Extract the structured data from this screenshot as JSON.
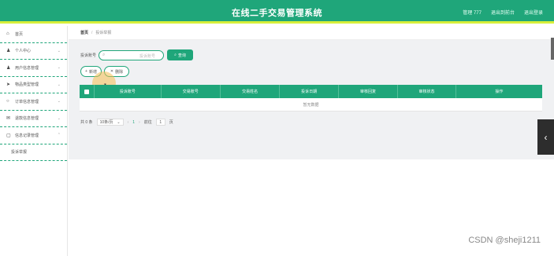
{
  "header": {
    "title": "在线二手交易管理系统",
    "links": [
      "管理 777",
      "退出到前台",
      "退出登录"
    ]
  },
  "sidebar": {
    "items": [
      {
        "label": "首页",
        "icon": "home-icon",
        "glyph": "⌂",
        "chevron": false
      },
      {
        "label": "个人中心",
        "icon": "user-icon",
        "glyph": "♟",
        "chevron": true
      },
      {
        "label": "用户信息管理",
        "icon": "user-group-icon",
        "glyph": "♟",
        "chevron": true
      },
      {
        "label": "物品类型管理",
        "icon": "send-icon",
        "glyph": "➤",
        "chevron": true
      },
      {
        "label": "订单信息管理",
        "icon": "circle-icon",
        "glyph": "○",
        "chevron": true
      },
      {
        "label": "退款信息管理",
        "icon": "mail-icon",
        "glyph": "✉",
        "chevron": true
      },
      {
        "label": "信息记录管理",
        "icon": "document-icon",
        "glyph": "▢",
        "chevron": true
      },
      {
        "label": "投诉举报",
        "icon": "",
        "glyph": "",
        "chevron": false,
        "sub": true
      }
    ]
  },
  "breadcrumb": {
    "home": "首页",
    "separator": "/",
    "current": "投诉举报"
  },
  "search": {
    "label": "投诉账号",
    "placeholder": "投诉账号",
    "button": "查询"
  },
  "actions": {
    "add": "新增",
    "delete": "删除"
  },
  "table": {
    "columns": [
      "投诉账号",
      "交易账号",
      "交易姓名",
      "投诉日期",
      "审核回复",
      "审核状态",
      "操作"
    ],
    "empty_text": "暂无数据"
  },
  "pager": {
    "total": "共 0 条",
    "page_size": "10条/页",
    "prev": "‹",
    "page": "1",
    "next": "›",
    "goto_label": "前往",
    "goto_value": "1",
    "page_suffix": "页"
  },
  "side_tab": {
    "glyph": "‹"
  },
  "watermark": "CSDN @sheji1211",
  "colors": {
    "primary": "#1fa67a",
    "accent": "#d7ef3a"
  }
}
